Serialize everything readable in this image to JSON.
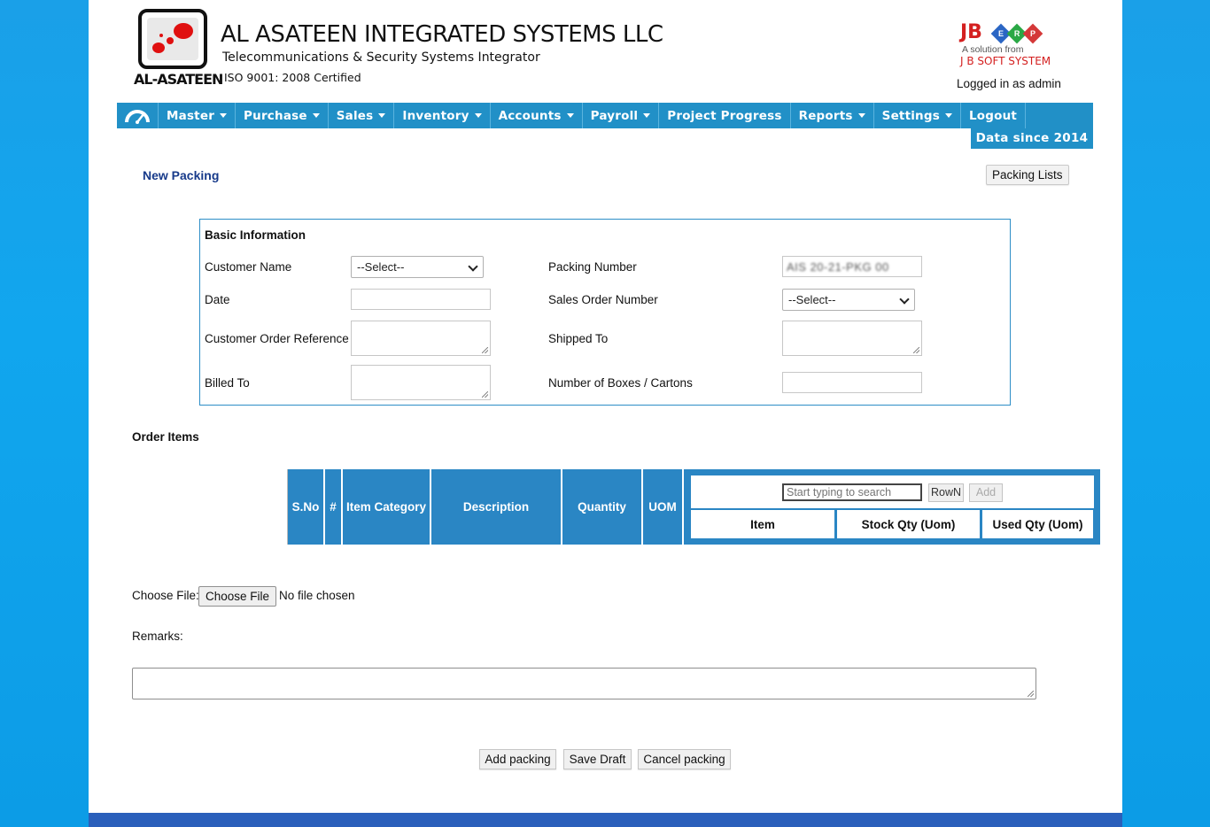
{
  "header": {
    "logo_text": "AL-ASATEEN",
    "company_name": "AL ASATEEN INTEGRATED SYSTEMS LLC",
    "tagline": "Telecommunications & Security Systems Integrator",
    "certification": "ISO 9001: 2008 Certified",
    "vendor": {
      "brand": "JB",
      "erp_letters": [
        "E",
        "R",
        "P"
      ],
      "line1": "A solution from",
      "line2": "J B SOFT SYSTEM"
    },
    "logged_in": "Logged in as admin"
  },
  "nav": {
    "home_icon": "dashboard-gauge-icon",
    "items": [
      {
        "label": "Master",
        "dropdown": true
      },
      {
        "label": "Purchase",
        "dropdown": true
      },
      {
        "label": "Sales",
        "dropdown": true
      },
      {
        "label": "Inventory",
        "dropdown": true
      },
      {
        "label": "Accounts",
        "dropdown": true
      },
      {
        "label": "Payroll",
        "dropdown": true
      },
      {
        "label": "Project Progress",
        "dropdown": false
      },
      {
        "label": "Reports",
        "dropdown": true
      },
      {
        "label": "Settings",
        "dropdown": true
      },
      {
        "label": "Logout",
        "dropdown": false
      }
    ],
    "data_since": "Data since 2014"
  },
  "page": {
    "title": "New Packing",
    "packing_lists_button": "Packing Lists"
  },
  "basic_info": {
    "title": "Basic Information",
    "customer_name_label": "Customer Name",
    "customer_name_value": "--Select--",
    "date_label": "Date",
    "date_value": "",
    "customer_order_ref_label": "Customer Order Reference",
    "billed_to_label": "Billed To",
    "packing_number_label": "Packing Number",
    "packing_number_value": "AIS 20-21-PKG 00",
    "sales_order_label": "Sales Order Number",
    "sales_order_value": "--Select--",
    "shipped_to_label": "Shipped To",
    "boxes_label": "Number of Boxes / Cartons"
  },
  "order_items": {
    "title": "Order Items",
    "columns": [
      "S.No",
      "#",
      "Item Category",
      "Description",
      "Quantity",
      "UOM"
    ],
    "search_placeholder": "Start typing to search",
    "row_button": "RowN",
    "add_button": "Add",
    "sub_columns": [
      "Item",
      "Stock Qty (Uom)",
      "Used Qty (Uom)"
    ]
  },
  "attachment": {
    "label": "Choose File:",
    "button": "Choose File",
    "status": "No file chosen"
  },
  "remarks": {
    "label": "Remarks:"
  },
  "actions": {
    "add": "Add packing",
    "draft": "Save Draft",
    "cancel": "Cancel packing"
  },
  "colors": {
    "nav_bg": "#2190c7",
    "background": "#11a6ee",
    "title_blue": "#173a8a",
    "table_header": "#2a86c4"
  }
}
